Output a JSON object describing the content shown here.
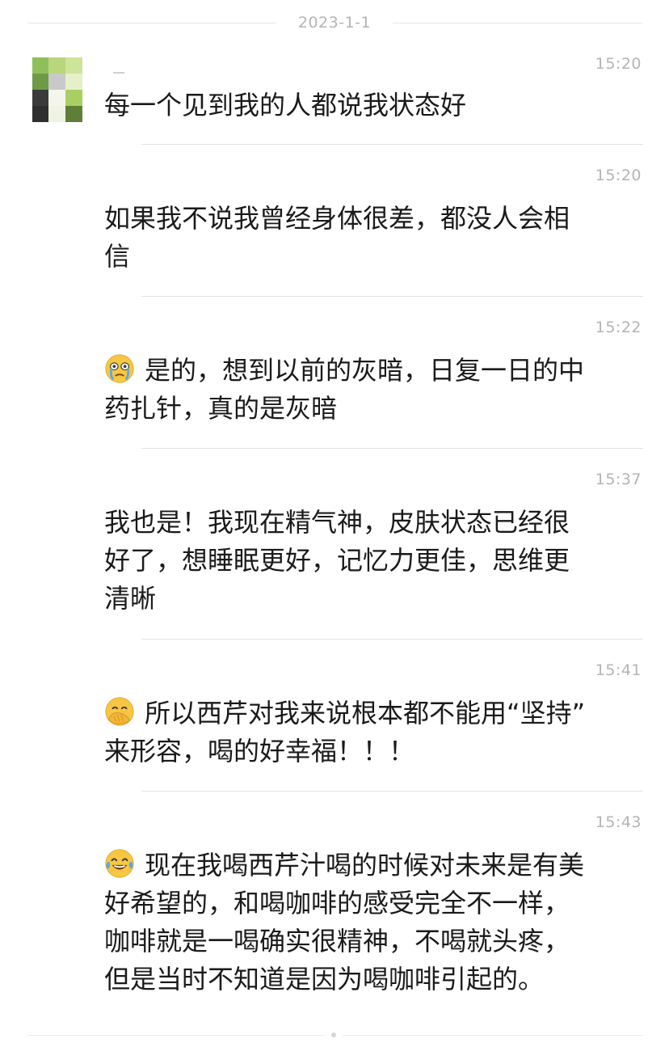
{
  "date_separator": "2023-1-1",
  "messages": [
    {
      "time": "15:20",
      "text": "每一个见到我的人都说我状态好",
      "emoji": null
    },
    {
      "time": "15:20",
      "text": "如果我不说我曾经身体很差，都没人会相\n信",
      "emoji": null
    },
    {
      "time": "15:22",
      "text": "是的，想到以前的灰暗，日复一日的中\n药扎针，真的是灰暗",
      "emoji": "crying-face-icon"
    },
    {
      "time": "15:37",
      "text": "我也是！我现在精气神，皮肤状态已经很\n好了，想睡眠更好，记忆力更佳，思维更\n清晰",
      "emoji": null
    },
    {
      "time": "15:41",
      "text": "所以西芹对我来说根本都不能用“坚持”\n来形容，喝的好幸福！！！",
      "emoji": "face-palm-icon"
    },
    {
      "time": "15:43",
      "text": "现在我喝西芹汁喝的时候对未来是有美\n好希望的，和喝咖啡的感受完全不一样，\n咖啡就是一喝确实很精神，不喝就头疼，\n但是当时不知道是因为喝咖啡引起的。",
      "emoji": "tears-of-joy-icon"
    }
  ],
  "colors": {
    "text": "#1a1a1a",
    "meta": "#b4b4b4",
    "divider": "#e3e3e3",
    "emoji_yellow": "#f7c744",
    "emoji_blue": "#5aa9e6"
  }
}
